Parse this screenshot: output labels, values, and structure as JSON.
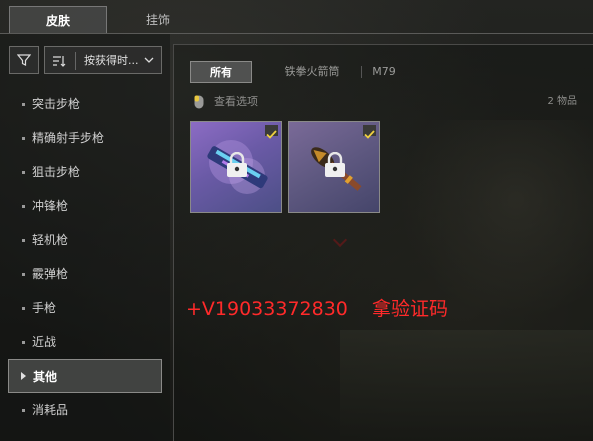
{
  "top_tabs": {
    "skins": "皮肤",
    "accessories": "挂饰"
  },
  "sort": {
    "label": "按获得时..."
  },
  "categories": [
    {
      "label": "突击步枪"
    },
    {
      "label": "精确射手步枪"
    },
    {
      "label": "狙击步枪"
    },
    {
      "label": "冲锋枪"
    },
    {
      "label": "轻机枪"
    },
    {
      "label": "霰弹枪"
    },
    {
      "label": "手枪"
    },
    {
      "label": "近战"
    },
    {
      "label": "其他",
      "active": true
    },
    {
      "label": "消耗品"
    }
  ],
  "sub_tabs": {
    "all": "所有",
    "rocket": "铁拳火箭筒",
    "m79": "M79"
  },
  "view_options": "查看选项",
  "item_count": "2 物品",
  "items": [
    {
      "icon": "lock-icon",
      "checked": true
    },
    {
      "icon": "lock-icon",
      "checked": true
    }
  ],
  "overlay_text": "+V19033372830    拿验证码",
  "colors": {
    "accent_check": "#f0d040",
    "overlay": "#ff2a2a"
  }
}
